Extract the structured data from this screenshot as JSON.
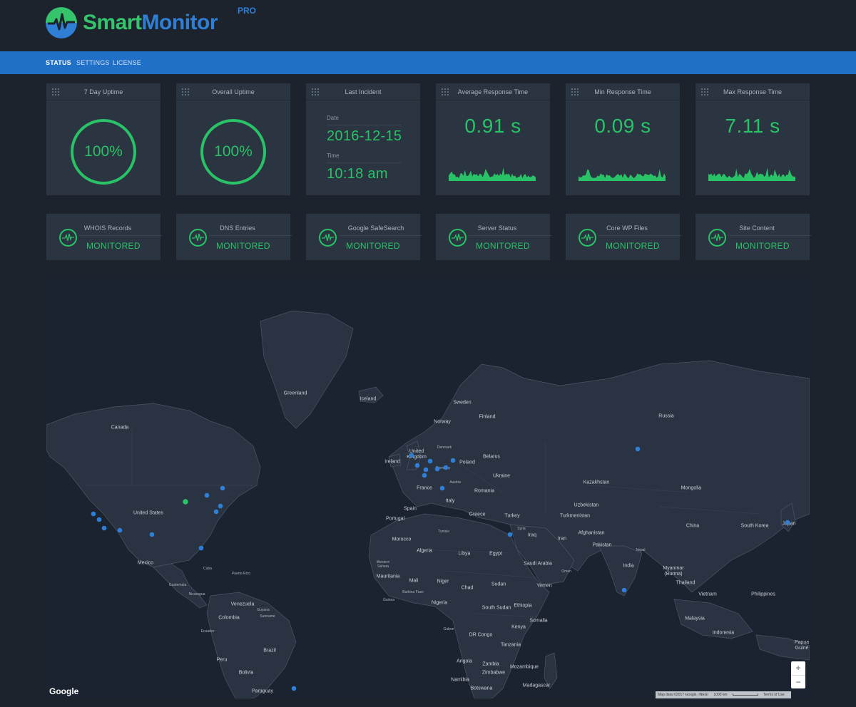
{
  "app": {
    "brand_part1": "Smart",
    "brand_part2": "Monitor",
    "brand_badge": "PRO",
    "colors": {
      "accent_green": "#29c266",
      "brand_blue": "#2f7fd6",
      "nav_blue": "#2170c8",
      "panel": "#2b3441",
      "background": "#1d232d",
      "map_dot": "#2f7fd6"
    }
  },
  "nav": {
    "items": [
      {
        "label": "STATUS",
        "active": true
      },
      {
        "label": "SETTINGS",
        "active": false
      },
      {
        "label": "LICENSE",
        "active": false
      }
    ]
  },
  "stats": {
    "uptime_7day": {
      "title": "7 Day Uptime",
      "value": "100%"
    },
    "uptime_overall": {
      "title": "Overall Uptime",
      "value": "100%"
    },
    "last_incident": {
      "title": "Last Incident",
      "date_label": "Date",
      "date": "2016-12-15",
      "time_label": "Time",
      "time": "10:18 am"
    },
    "avg_response": {
      "title": "Average Response Time",
      "value": "0.91 s"
    },
    "min_response": {
      "title": "Min Response Time",
      "value": "0.09 s"
    },
    "max_response": {
      "title": "Max Response Time",
      "value": "7.11 s"
    }
  },
  "monitors": [
    {
      "title": "WHOIS Records",
      "status": "MONITORED",
      "icon": "pulse-icon"
    },
    {
      "title": "DNS Entries",
      "status": "MONITORED",
      "icon": "pulse-icon"
    },
    {
      "title": "Google SafeSearch",
      "status": "MONITORED",
      "icon": "pulse-icon"
    },
    {
      "title": "Server Status",
      "status": "MONITORED",
      "icon": "pulse-icon"
    },
    {
      "title": "Core WP Files",
      "status": "MONITORED",
      "icon": "pulse-icon"
    },
    {
      "title": "Site Content",
      "status": "MONITORED",
      "icon": "pulse-icon"
    }
  ],
  "map": {
    "labels": {
      "greenland": "Greenland",
      "iceland": "Iceland",
      "sweden": "Sweden",
      "finland": "Finland",
      "norway": "Norway",
      "russia": "Russia",
      "canada": "Canada",
      "united_kingdom": "United Kingdom",
      "denmark": "Denmark",
      "belarus": "Belarus",
      "ireland": "Ireland",
      "poland": "Poland",
      "germany": "Germany",
      "ukraine": "Ukraine",
      "france": "France",
      "austria": "Austria",
      "romania": "Romania",
      "kazakhstan": "Kazakhstan",
      "mongolia": "Mongolia",
      "spain": "Spain",
      "italy": "Italy",
      "uzbekistan": "Uzbekistan",
      "united_states": "United States",
      "portugal": "Portugal",
      "greece": "Greece",
      "turkey": "Turkey",
      "turkmenistan": "Turkmenistan",
      "afghanistan": "Afghanistan",
      "china": "China",
      "south_korea": "South Korea",
      "japan": "Japan",
      "tunisia": "Tunisia",
      "syria": "Syria",
      "iraq": "Iraq",
      "iran": "Iran",
      "morocco": "Morocco",
      "pakistan": "Pakistan",
      "algeria": "Algeria",
      "libya": "Libya",
      "egypt": "Egypt",
      "nepal": "Nepal",
      "mexico": "Mexico",
      "saudi_arabia": "Saudi Arabia",
      "cuba": "Cuba",
      "oman": "Oman",
      "india": "India",
      "myanmar": "Myanmar (Burma)",
      "western_sahara": "Western Sahara",
      "puerto_rico": "Puerto Rico",
      "mauritania": "Mauritania",
      "mali": "Mali",
      "niger": "Niger",
      "guatemala": "Guatemala",
      "chad": "Chad",
      "sudan": "Sudan",
      "yemen": "Yemen",
      "thailand": "Thailand",
      "nicaragua": "Nicaragua",
      "burkina_faso": "Burkina Faso",
      "vietnam": "Vietnam",
      "philippines": "Philippines",
      "venezuela": "Venezuela",
      "guinea": "Guinea",
      "nigeria": "Nigeria",
      "south_sudan": "South Sudan",
      "ethiopia": "Ethiopia",
      "guyana": "Guyana",
      "colombia": "Colombia",
      "somalia": "Somalia",
      "suriname": "Suriname",
      "malaysia": "Malaysia",
      "ecuador": "Ecuador",
      "kenya": "Kenya",
      "gabon": "Gabon",
      "dr_congo": "DR Congo",
      "indonesia": "Indonesia",
      "brazil": "Brazil",
      "peru": "Peru",
      "tanzania": "Tanzania",
      "papua": "Papua Guine",
      "angola": "Angola",
      "zambia": "Zambia",
      "mozambique": "Mozambique",
      "bolivia": "Bolivia",
      "zimbabwe": "Zimbabwe",
      "namibia": "Namibia",
      "madagascar": "Madagascar",
      "botswana": "Botswana",
      "paraguay": "Paraguay"
    },
    "google_logo": "Google",
    "zoom_in": "+",
    "zoom_out": "−",
    "attribution": "Map data ©2017 Google, INEGI",
    "scale_label": "1000 km",
    "terms": "Terms of Use"
  }
}
